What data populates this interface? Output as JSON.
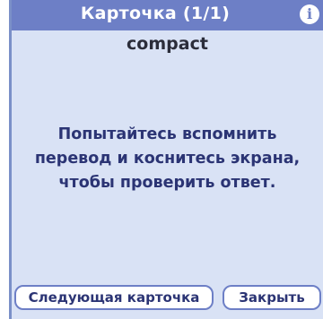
{
  "header": {
    "title": "Карточка (1/1)",
    "info_label": "i"
  },
  "card": {
    "word": "compact",
    "hint_line1": "Попытайтесь вспомнить",
    "hint_line2": "перевод и коснитесь экрана,",
    "hint_line3": "чтобы проверить ответ."
  },
  "buttons": {
    "next_card": "Следующая карточка",
    "close": "Закрыть"
  },
  "colors": {
    "titlebar": "#6d7fc6",
    "background": "#d9e2f5",
    "text_dark": "#2b3474"
  }
}
